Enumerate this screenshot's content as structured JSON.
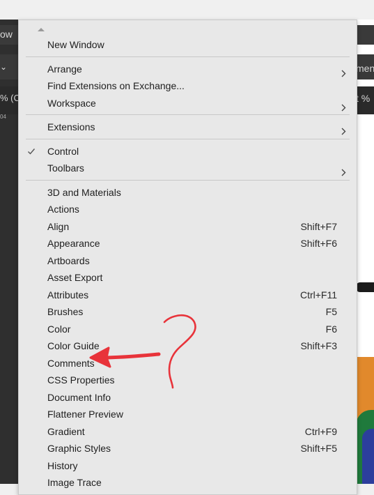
{
  "background": {
    "left_labels": [
      "ow",
      "% (C",
      "04"
    ],
    "right_labels": [
      "ment",
      "t %"
    ]
  },
  "menu": {
    "groups": [
      [
        {
          "label": "New Window",
          "shortcut": "",
          "submenu": false,
          "checked": false
        }
      ],
      [
        {
          "label": "Arrange",
          "shortcut": "",
          "submenu": true,
          "checked": false
        },
        {
          "label": "Find Extensions on Exchange...",
          "shortcut": "",
          "submenu": false,
          "checked": false
        },
        {
          "label": "Workspace",
          "shortcut": "",
          "submenu": true,
          "checked": false
        }
      ],
      [
        {
          "label": "Extensions",
          "shortcut": "",
          "submenu": true,
          "checked": false
        }
      ],
      [
        {
          "label": "Control",
          "shortcut": "",
          "submenu": false,
          "checked": true
        },
        {
          "label": "Toolbars",
          "shortcut": "",
          "submenu": true,
          "checked": false
        }
      ],
      [
        {
          "label": "3D and Materials",
          "shortcut": "",
          "submenu": false,
          "checked": false
        },
        {
          "label": "Actions",
          "shortcut": "",
          "submenu": false,
          "checked": false
        },
        {
          "label": "Align",
          "shortcut": "Shift+F7",
          "submenu": false,
          "checked": false
        },
        {
          "label": "Appearance",
          "shortcut": "Shift+F6",
          "submenu": false,
          "checked": false
        },
        {
          "label": "Artboards",
          "shortcut": "",
          "submenu": false,
          "checked": false
        },
        {
          "label": "Asset Export",
          "shortcut": "",
          "submenu": false,
          "checked": false
        },
        {
          "label": "Attributes",
          "shortcut": "Ctrl+F11",
          "submenu": false,
          "checked": false
        },
        {
          "label": "Brushes",
          "shortcut": "F5",
          "submenu": false,
          "checked": false
        },
        {
          "label": "Color",
          "shortcut": "F6",
          "submenu": false,
          "checked": false
        },
        {
          "label": "Color Guide",
          "shortcut": "Shift+F3",
          "submenu": false,
          "checked": false
        },
        {
          "label": "Comments",
          "shortcut": "",
          "submenu": false,
          "checked": false
        },
        {
          "label": "CSS Properties",
          "shortcut": "",
          "submenu": false,
          "checked": false
        },
        {
          "label": "Document Info",
          "shortcut": "",
          "submenu": false,
          "checked": false
        },
        {
          "label": "Flattener Preview",
          "shortcut": "",
          "submenu": false,
          "checked": false
        },
        {
          "label": "Gradient",
          "shortcut": "Ctrl+F9",
          "submenu": false,
          "checked": false
        },
        {
          "label": "Graphic Styles",
          "shortcut": "Shift+F5",
          "submenu": false,
          "checked": false
        },
        {
          "label": "History",
          "shortcut": "",
          "submenu": false,
          "checked": false
        },
        {
          "label": "Image Trace",
          "shortcut": "",
          "submenu": false,
          "checked": false
        }
      ]
    ],
    "icons": {
      "check": "check-icon",
      "submenu": "chevron-right-icon",
      "scroll": "scroll-up-icon"
    }
  },
  "annotation": {
    "color": "#e8333a",
    "arrow_target": "Comments",
    "mark": "question-mark"
  },
  "colors": {
    "menu_bg": "#e8e8e8",
    "separator": "#c8c8c8",
    "app_dark": "#2f2f2f",
    "art_orange": "#e1892c",
    "art_green": "#1f7a3c",
    "art_blue": "#2c3e9c"
  }
}
